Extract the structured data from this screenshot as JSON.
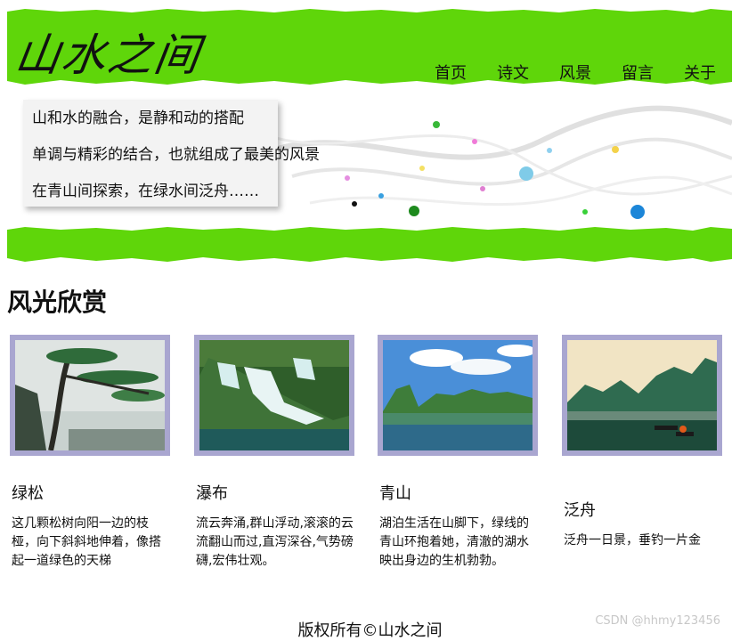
{
  "header": {
    "logo": "山水之间",
    "nav": [
      "首页",
      "诗文",
      "风景",
      "留言",
      "关于"
    ]
  },
  "banner": {
    "lines": [
      "山和水的融合，是静和动的搭配",
      "单调与精彩的结合，也就组成了最美的风景",
      "在青山间探索，在绿水间泛舟……"
    ]
  },
  "section": {
    "title": "风光欣赏"
  },
  "cards": [
    {
      "title": "绿松",
      "text": "这几颗松树向阳一边的枝桠，向下斜斜地伸着，像搭起一道绿色的天梯"
    },
    {
      "title": "瀑布",
      "text": "流云奔涌,群山浮动,滚滚的云流翻山而过,直泻深谷,气势磅礴,宏伟壮观。"
    },
    {
      "title": "青山",
      "text": "湖泊生活在山脚下，绿线的青山环抱着她，清澈的湖水映出身边的生机勃勃。"
    },
    {
      "title": "泛舟",
      "text": "泛舟一日景，垂钓一片金"
    }
  ],
  "footer": {
    "text": "版权所有©山水之间"
  },
  "watermark": "CSDN @hhmy123456",
  "colors": {
    "brand_green": "#5fd60a",
    "photo_frame": "#a9a6d0"
  }
}
